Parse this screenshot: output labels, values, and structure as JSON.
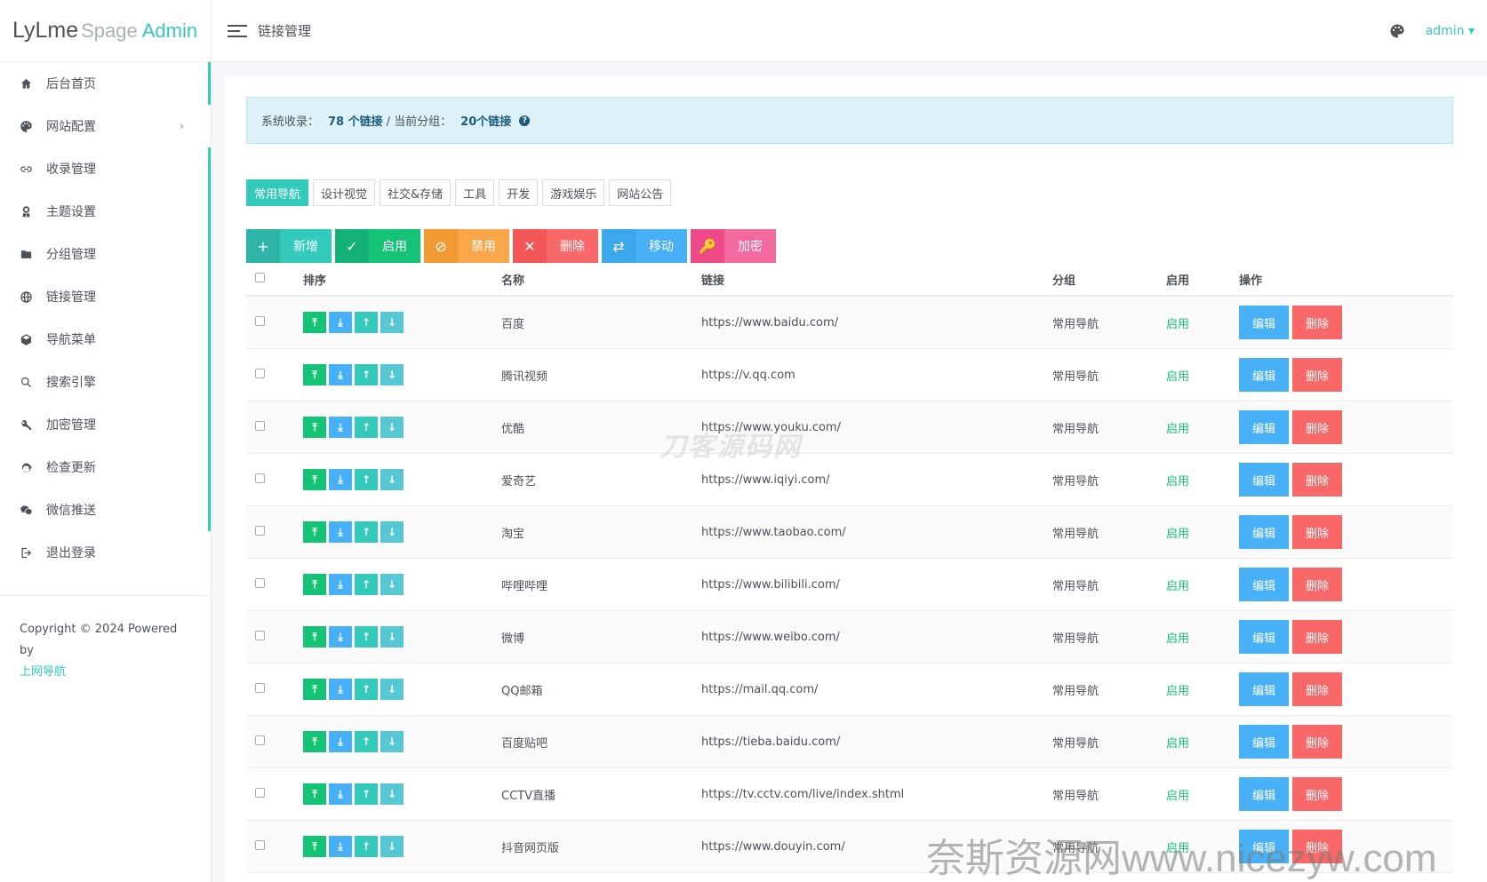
{
  "logo": {
    "part1": "LyLme",
    "part2": "Spage",
    "part3": "Admin"
  },
  "sidebar": {
    "items": [
      {
        "label": "后台首页",
        "icon": "home-icon"
      },
      {
        "label": "网站配置",
        "icon": "palette-icon",
        "arrow": "›"
      },
      {
        "label": "收录管理",
        "icon": "link-icon"
      },
      {
        "label": "主题设置",
        "icon": "award-icon"
      },
      {
        "label": "分组管理",
        "icon": "folder-icon"
      },
      {
        "label": "链接管理",
        "icon": "globe-icon"
      },
      {
        "label": "导航菜单",
        "icon": "cube-icon"
      },
      {
        "label": "搜索引擎",
        "icon": "search-icon"
      },
      {
        "label": "加密管理",
        "icon": "key-icon"
      },
      {
        "label": "检查更新",
        "icon": "refresh-icon"
      },
      {
        "label": "微信推送",
        "icon": "wechat-icon"
      },
      {
        "label": "退出登录",
        "icon": "logout-icon"
      }
    ],
    "copyright": "Copyright © 2024 Powered by",
    "copyright_link": "上网导航"
  },
  "header": {
    "title": "链接管理",
    "user": "admin ▾"
  },
  "alert": {
    "prefix": "系统收录：",
    "total": "78 个链接",
    "mid": "/ 当前分组：",
    "group_count": "20个链接",
    "help": "?"
  },
  "tabs": [
    "常用导航",
    "设计视觉",
    "社交&存储",
    "工具",
    "开发",
    "游戏娱乐",
    "网站公告"
  ],
  "actions": [
    {
      "icon": "+",
      "label": "新增"
    },
    {
      "icon": "✓",
      "label": "启用"
    },
    {
      "icon": "⊘",
      "label": "禁用"
    },
    {
      "icon": "✕",
      "label": "删除"
    },
    {
      "icon": "⇄",
      "label": "移动"
    },
    {
      "icon": "🔑",
      "label": "加密"
    }
  ],
  "table": {
    "headers": {
      "sort": "排序",
      "name": "名称",
      "link": "链接",
      "group": "分组",
      "status": "启用",
      "op": "操作"
    },
    "sort_icons": [
      "⤒",
      "⤓",
      "↑",
      "↓"
    ],
    "edit_label": "编辑",
    "delete_label": "删除",
    "rows": [
      {
        "name": "百度",
        "link": "https://www.baidu.com/",
        "group": "常用导航",
        "status": "启用"
      },
      {
        "name": "腾讯视频",
        "link": "https://v.qq.com",
        "group": "常用导航",
        "status": "启用"
      },
      {
        "name": "优酷",
        "link": "https://www.youku.com/",
        "group": "常用导航",
        "status": "启用"
      },
      {
        "name": "爱奇艺",
        "link": "https://www.iqiyi.com/",
        "group": "常用导航",
        "status": "启用"
      },
      {
        "name": "淘宝",
        "link": "https://www.taobao.com/",
        "group": "常用导航",
        "status": "启用"
      },
      {
        "name": "哔哩哔哩",
        "link": "https://www.bilibili.com/",
        "group": "常用导航",
        "status": "启用"
      },
      {
        "name": "微博",
        "link": "https://www.weibo.com/",
        "group": "常用导航",
        "status": "启用"
      },
      {
        "name": "QQ邮箱",
        "link": "https://mail.qq.com/",
        "group": "常用导航",
        "status": "启用"
      },
      {
        "name": "百度贴吧",
        "link": "https://tieba.baidu.com/",
        "group": "常用导航",
        "status": "启用"
      },
      {
        "name": "CCTV直播",
        "link": "https://tv.cctv.com/live/index.shtml",
        "group": "常用导航",
        "status": "启用"
      },
      {
        "name": "抖音网页版",
        "link": "https://www.douyin.com/",
        "group": "常用导航",
        "status": "启用"
      }
    ]
  },
  "watermarks": {
    "center": "刀客源码网",
    "bottom": "奈斯资源网www.nicezyw.com"
  }
}
